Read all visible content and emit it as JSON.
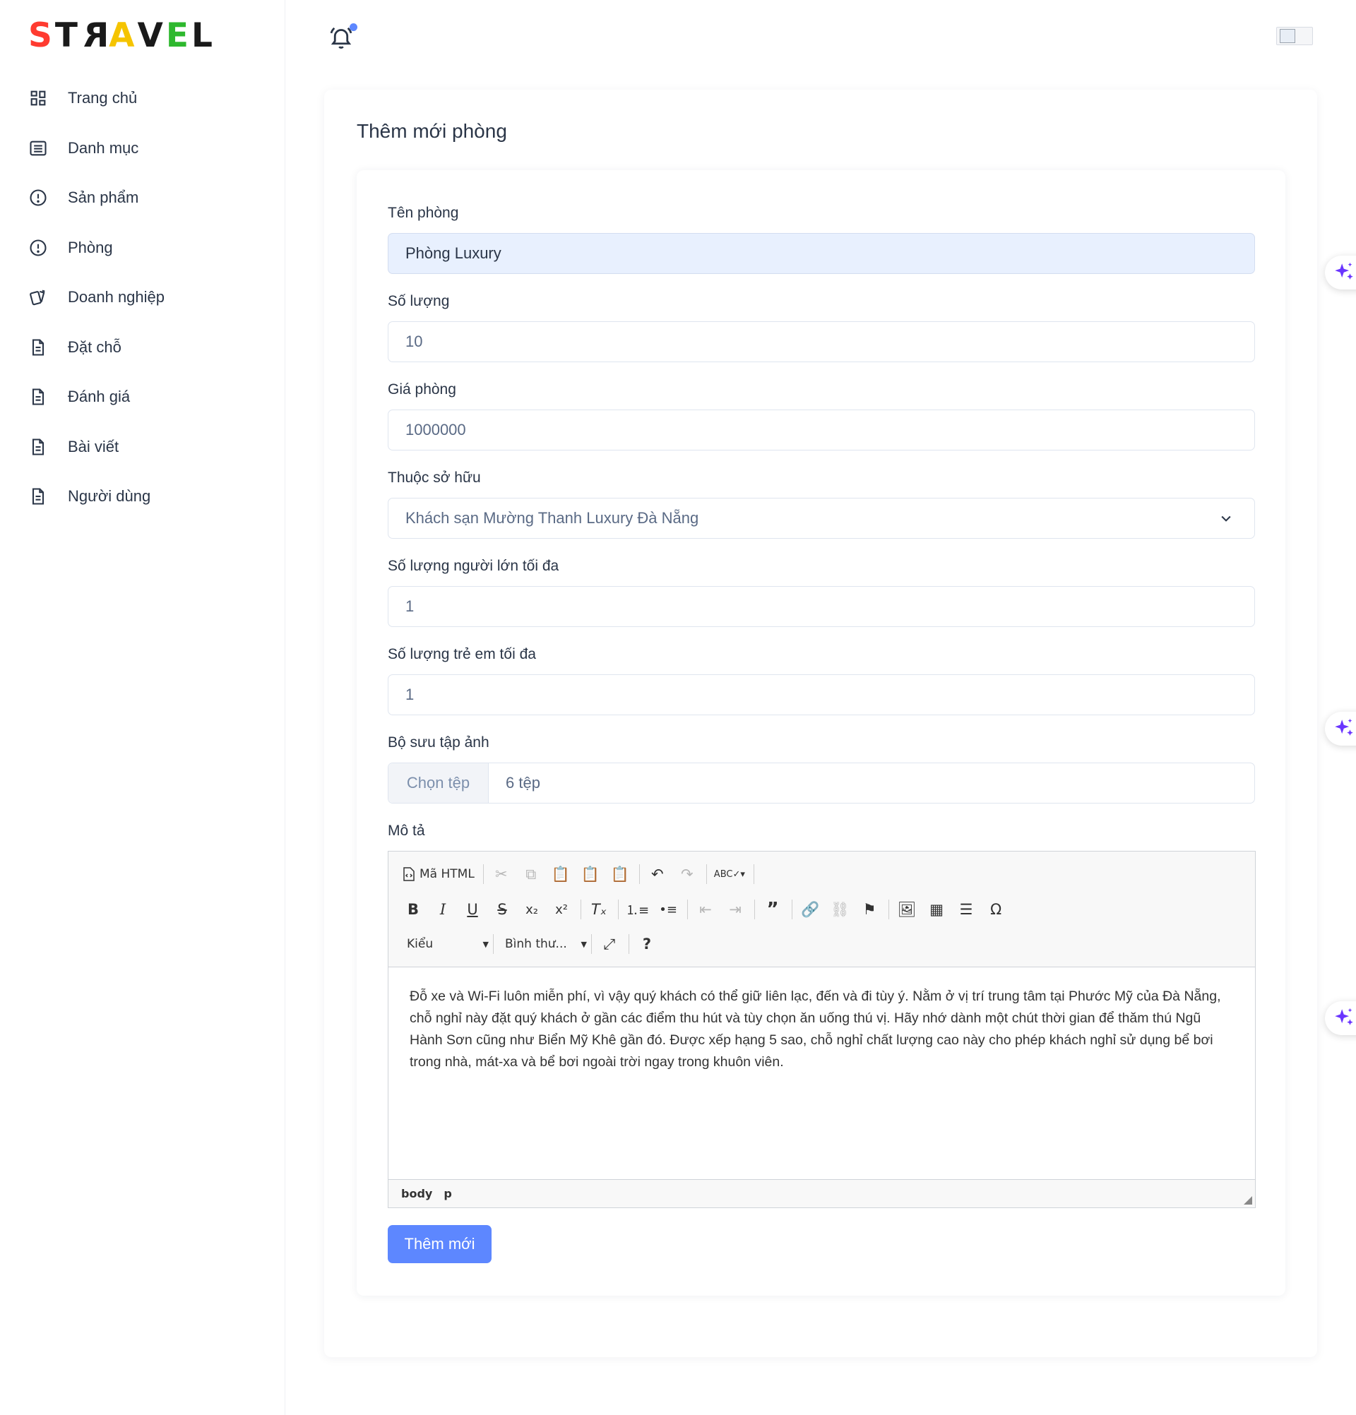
{
  "brand": {
    "letters": [
      "S",
      "T",
      "R",
      "A",
      "V",
      "E",
      "L"
    ],
    "letter_colors": [
      "#ff3b30",
      "#1a1a1a",
      "#1a1a1a",
      "#f5c400",
      "#1a1a1a",
      "#2eb82e",
      "#1a1a1a"
    ]
  },
  "sidebar": {
    "items": [
      {
        "label": "Trang chủ",
        "icon": "dashboard-icon"
      },
      {
        "label": "Danh mục",
        "icon": "list-icon"
      },
      {
        "label": "Sản phẩm",
        "icon": "alert-circle-icon"
      },
      {
        "label": "Phòng",
        "icon": "alert-circle-icon"
      },
      {
        "label": "Doanh nghiệp",
        "icon": "cards-icon"
      },
      {
        "label": "Đặt chỗ",
        "icon": "file-text-icon"
      },
      {
        "label": "Đánh giá",
        "icon": "file-text-icon"
      },
      {
        "label": "Bài viết",
        "icon": "file-text-icon"
      },
      {
        "label": "Người dùng",
        "icon": "file-text-icon"
      }
    ]
  },
  "page": {
    "title": "Thêm mới phòng"
  },
  "form": {
    "name_label": "Tên phòng",
    "name_value": "Phòng Luxury",
    "quantity_label": "Số lượng",
    "quantity_value": "10",
    "price_label": "Giá phòng",
    "price_value": "1000000",
    "owner_label": "Thuộc sở hữu",
    "owner_value": "Khách sạn Mường Thanh Luxury Đà Nẵng",
    "max_adults_label": "Số lượng người lớn tối đa",
    "max_adults_value": "1",
    "max_children_label": "Số lượng trẻ em tối đa",
    "max_children_value": "1",
    "gallery_label": "Bộ sưu tập ảnh",
    "gallery_button": "Chọn tệp",
    "gallery_value": "6 tệp",
    "description_label": "Mô tả",
    "submit_label": "Thêm mới"
  },
  "editor": {
    "source_label": "Mã HTML",
    "style_combo": "Kiểu",
    "format_combo": "Bình thư...",
    "content": "Đỗ xe và Wi-Fi luôn miễn phí, vì vậy quý khách có thể giữ liên lạc, đến và đi tùy ý. Nằm ở vị trí trung tâm tại Phước Mỹ của Đà Nẵng, chỗ nghỉ này đặt quý khách ở gần các điểm thu hút và tùy chọn ăn uống thú vị. Hãy nhớ dành một chút thời gian để thăm thú Ngũ Hành Sơn cũng như Biển Mỹ Khê gần đó. Được xếp hạng 5 sao, chỗ nghỉ chất lượng cao này cho phép khách nghỉ sử dụng bể bơi trong nhà, mát-xa và bể bơi ngoài trời ngay trong khuôn viên.",
    "status_path": [
      "body",
      "p"
    ]
  },
  "colors": {
    "primary": "#5d87ff",
    "sparkle": "#6a35ff",
    "text": "#2a3547"
  }
}
